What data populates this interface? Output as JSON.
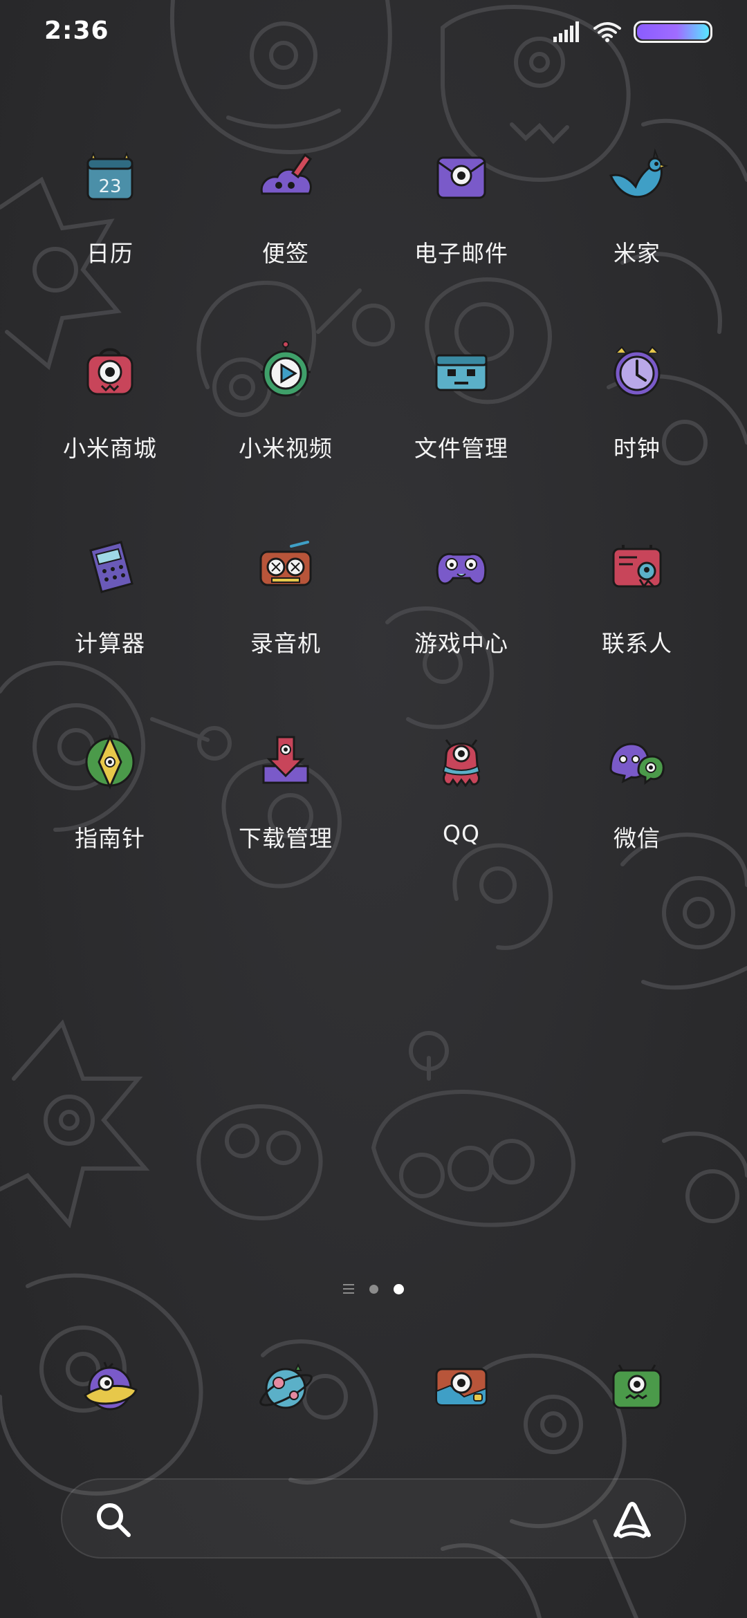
{
  "status_bar": {
    "time": "2:36",
    "signal_icon": "cellular-signal-icon",
    "wifi_icon": "wifi-icon",
    "battery_icon": "battery-icon",
    "battery_gradient": [
      "#8a5cff",
      "#57e6ff"
    ]
  },
  "apps": [
    {
      "label": "日历",
      "icon": "calendar-icon",
      "icon_text": "23"
    },
    {
      "label": "便签",
      "icon": "notes-icon"
    },
    {
      "label": "电子邮件",
      "icon": "email-icon"
    },
    {
      "label": "米家",
      "icon": "mijia-bird-icon"
    },
    {
      "label": "小米商城",
      "icon": "mi-store-icon"
    },
    {
      "label": "小米视频",
      "icon": "mi-video-icon"
    },
    {
      "label": "文件管理",
      "icon": "file-manager-icon"
    },
    {
      "label": "时钟",
      "icon": "clock-icon"
    },
    {
      "label": "计算器",
      "icon": "calculator-icon"
    },
    {
      "label": "录音机",
      "icon": "recorder-icon"
    },
    {
      "label": "游戏中心",
      "icon": "game-center-icon"
    },
    {
      "label": "联系人",
      "icon": "contacts-icon"
    },
    {
      "label": "指南针",
      "icon": "compass-icon"
    },
    {
      "label": "下载管理",
      "icon": "download-manager-icon"
    },
    {
      "label": "QQ",
      "icon": "qq-icon"
    },
    {
      "label": "微信",
      "icon": "wechat-icon"
    }
  ],
  "page_indicator": {
    "pages": 2,
    "active_index": 1
  },
  "dock": [
    {
      "icon": "phone-monster-icon"
    },
    {
      "icon": "browser-planet-icon"
    },
    {
      "icon": "camera-icon"
    },
    {
      "icon": "messages-monster-icon"
    }
  ],
  "search_bar": {
    "search_icon": "search-icon",
    "assistant_icon": "assistant-icon"
  },
  "colors": {
    "background": "#2c2c2e",
    "label": "#f4f4f4",
    "indicator_inactive": "#8c8c8c",
    "indicator_active": "#ffffff"
  }
}
